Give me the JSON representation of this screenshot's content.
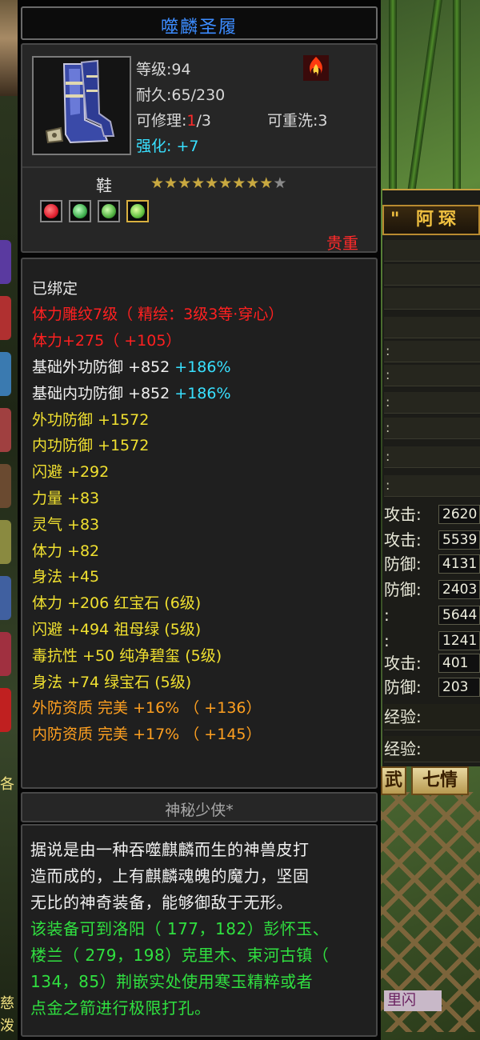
{
  "item": {
    "name": "噬麟圣履",
    "level_text": "等级:94",
    "durability_text": "耐久:65/230",
    "repair_label": "可修理:",
    "repair_current": "1",
    "repair_max": "/3",
    "rewash_text": "可重洗:3",
    "enhance_label": "强化:",
    "enhance_value": "+7",
    "type": "鞋",
    "stars_filled": "★★★★★★★★★",
    "stars_empty": "★",
    "star_count": 9,
    "star_total": 10,
    "rarity": "贵重",
    "gems": [
      {
        "name": "red-gem",
        "color": "#e02030"
      },
      {
        "name": "green-gem",
        "color": "#40b050"
      },
      {
        "name": "green-gem",
        "color": "#50b040"
      },
      {
        "name": "green-gem",
        "color": "#60c040"
      }
    ]
  },
  "properties": [
    {
      "text": "已绑定",
      "color": "white"
    },
    {
      "text": "体力雕纹7级（ 精绘：3级3等·穿心）",
      "color": "red"
    },
    {
      "text": "体力+275（ +105）",
      "color": "red"
    },
    {
      "text": "基础外功防御 +852",
      "extra": "+186%",
      "color": "base"
    },
    {
      "text": "基础内功防御 +852",
      "extra": "+186%",
      "color": "base"
    },
    {
      "text": "外功防御 +1572",
      "color": "yellow"
    },
    {
      "text": "内功防御 +1572",
      "color": "yellow"
    },
    {
      "text": "闪避 +292",
      "color": "yellow"
    },
    {
      "text": "力量 +83",
      "color": "yellow"
    },
    {
      "text": "灵气 +83",
      "color": "yellow"
    },
    {
      "text": "体力 +82",
      "color": "yellow"
    },
    {
      "text": "身法 +45",
      "color": "yellow"
    },
    {
      "text": "体力 +206 红宝石 (6级)",
      "color": "yellow"
    },
    {
      "text": "闪避 +494 祖母绿 (5级)",
      "color": "yellow"
    },
    {
      "text": "毒抗性 +50 纯净碧玺 (5级)",
      "color": "yellow"
    },
    {
      "text": "身法 +74 绿宝石 (5级)",
      "color": "yellow"
    },
    {
      "text": "外防资质   完美 +16% （ +136）",
      "color": "orange"
    },
    {
      "text": "内防资质   完美 +17% （ +145）",
      "color": "orange"
    }
  ],
  "maker": "神秘少侠*",
  "description": {
    "lore": [
      "据说是由一种吞噬麒麟而生的神兽皮打",
      "造而成的，上有麒麟魂魄的魔力，坚固",
      "无比的神奇装备，能够御敌于无形。"
    ],
    "hint": [
      "该装备可到洛阳（ 177，182）彭怀玉、",
      "楼兰（ 279，198）克里木、束河古镇（",
      "134，85）荆嵌实处使用寒玉精粹或者",
      "点金之箭进行极限打孔。"
    ]
  },
  "background_panel": {
    "quote": "\"",
    "name": "阿琛",
    "colon_rows": [
      ":",
      ":",
      ":",
      ":",
      ":",
      ":",
      ":"
    ],
    "stats": [
      {
        "label": "攻击:",
        "value": "2620"
      },
      {
        "label": "攻击:",
        "value": "5539"
      },
      {
        "label": "防御:",
        "value": "4131"
      },
      {
        "label": "防御:",
        "value": "2403"
      },
      {
        "label": ":",
        "value": "5644"
      },
      {
        "label": ":",
        "value": "1241"
      },
      {
        "label": "攻击:",
        "value": "401"
      },
      {
        "label": "防御:",
        "value": "203"
      }
    ],
    "exp_rows": [
      "经验:",
      "经验:"
    ],
    "tab_partial": "武",
    "tab_qiqing": "七情",
    "bottom_tag": "里闪",
    "left_char_1": "各",
    "left_char_2": "慈",
    "left_char_3": "泼"
  }
}
